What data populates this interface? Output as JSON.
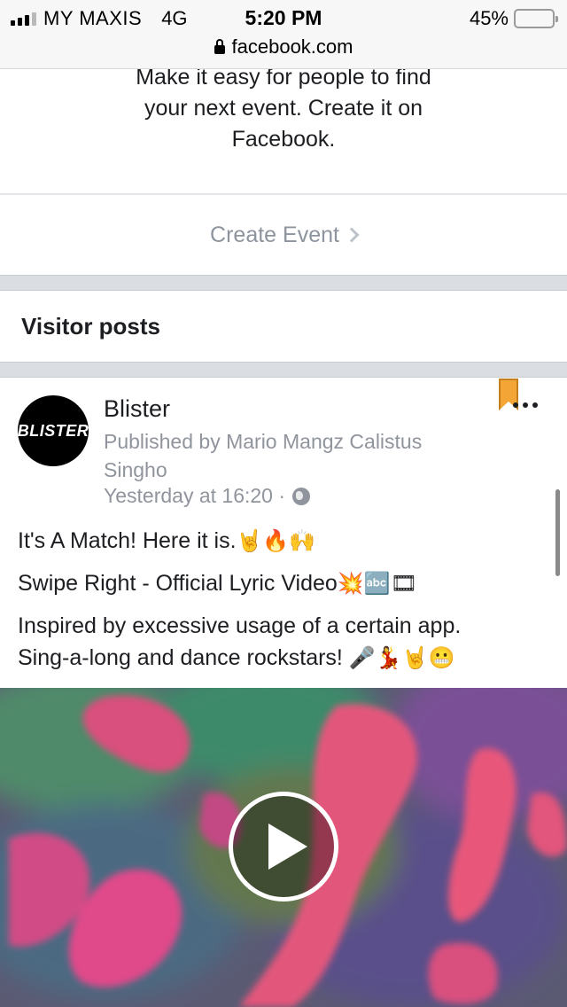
{
  "status_bar": {
    "carrier": "MY MAXIS",
    "network": "4G",
    "time": "5:20 PM",
    "battery": "45%",
    "battery_level": 0.45,
    "battery_color": "#f5c518"
  },
  "url_bar": {
    "domain": "facebook.com",
    "icon": "lock-icon"
  },
  "promo": {
    "lines": [
      "Make it easy for people to find",
      "your next event. Create it on",
      "Facebook."
    ]
  },
  "create_event": {
    "label": "Create Event"
  },
  "visitor_posts": {
    "heading": "Visitor posts"
  },
  "post": {
    "page_name": "Blister",
    "avatar_text": "BLISTER",
    "published_by": "Published by Mario Mangz Calistus Singho",
    "timestamp": "Yesterday at 16:20 ·",
    "privacy_icon": "globe-icon",
    "line1": "It's A Match! Here it is.",
    "line1_emojis": "🤘🔥🙌",
    "line2": "Swipe Right - Official Lyric Video",
    "line2_emojis": "💥🔤🎞",
    "line3": "Inspired by excessive usage of a certain app.",
    "line4": "Sing-a-long and dance rockstars!",
    "line4_emojis": "🎤💃🤘😬"
  },
  "colors": {
    "text": "#1c1e21",
    "muted": "#90949c",
    "separator": "#dadde1",
    "bookmark": "#f3a635"
  }
}
